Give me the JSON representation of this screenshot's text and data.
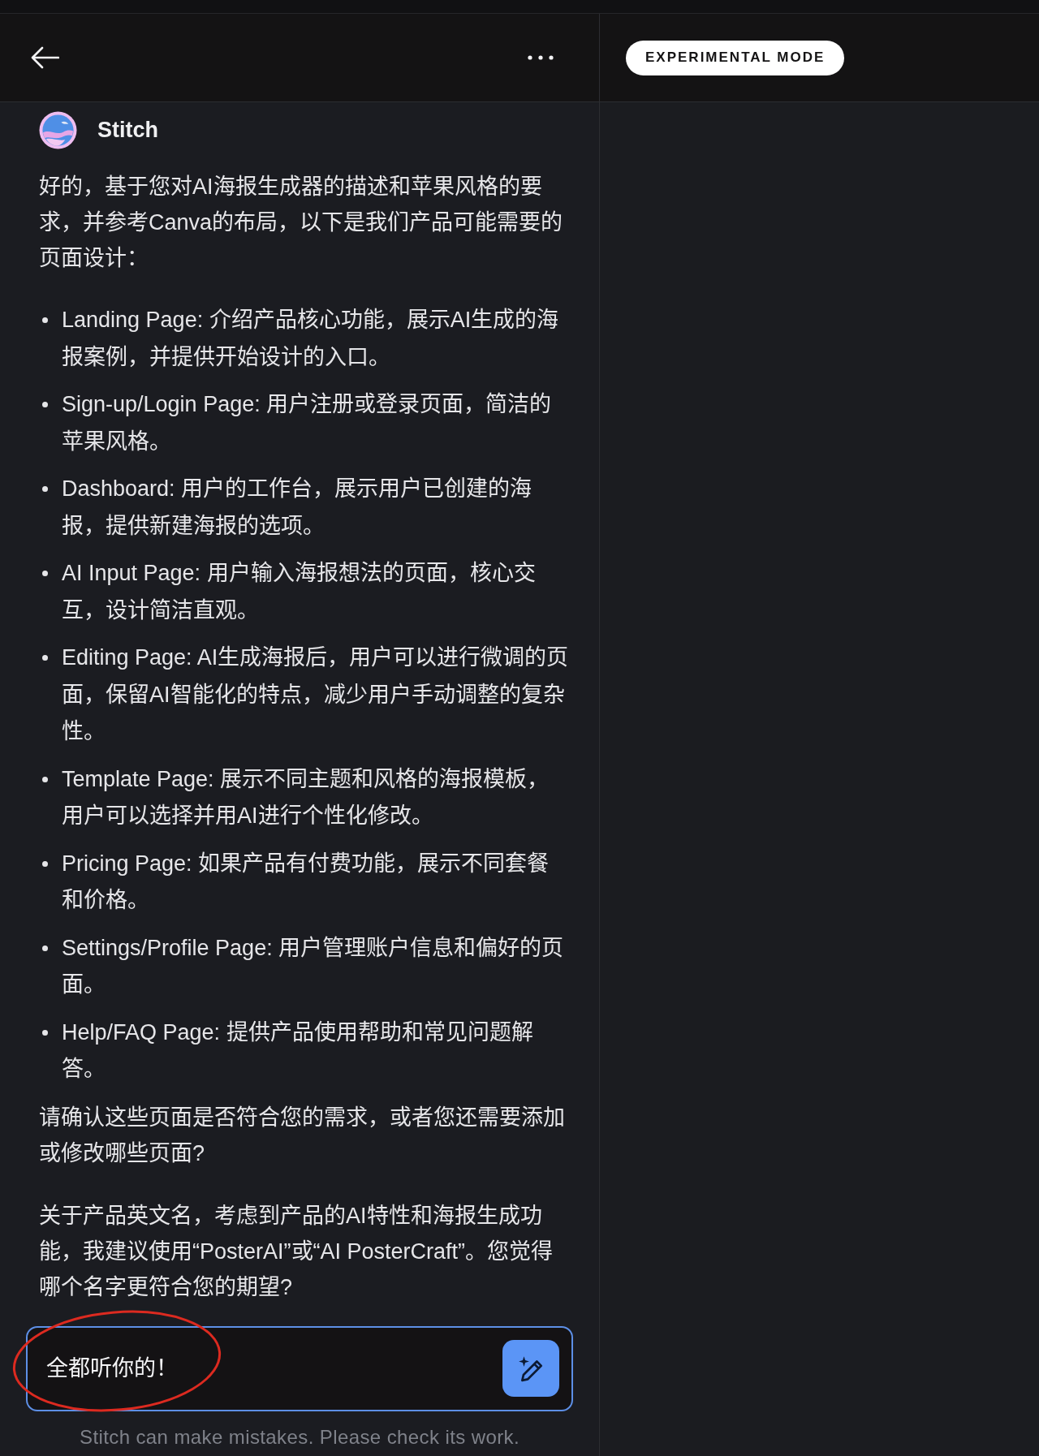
{
  "header": {
    "badge": "EXPERIMENTAL MODE"
  },
  "message": {
    "sender": "Stitch",
    "blocks": [
      {
        "kind": "paragraph",
        "text": "好的，基于您对AI海报生成器的描述和苹果风格的要求，并参考Canva的布局，以下是我们产品可能需要的页面设计："
      },
      {
        "kind": "list",
        "items": [
          "Landing Page: 介绍产品核心功能，展示AI生成的海报案例，并提供开始设计的入口。",
          "Sign-up/Login Page: 用户注册或登录页面，简洁的苹果风格。",
          "Dashboard: 用户的工作台，展示用户已创建的海报，提供新建海报的选项。",
          "AI Input Page: 用户输入海报想法的页面，核心交互，设计简洁直观。",
          "Editing Page: AI生成海报后，用户可以进行微调的页面，保留AI智能化的特点，减少用户手动调整的复杂性。",
          "Template Page: 展示不同主题和风格的海报模板，用户可以选择并用AI进行个性化修改。",
          "Pricing Page: 如果产品有付费功能，展示不同套餐和价格。",
          "Settings/Profile Page: 用户管理账户信息和偏好的页面。",
          "Help/FAQ Page: 提供产品使用帮助和常见问题解答。"
        ]
      },
      {
        "kind": "paragraph",
        "text": "请确认这些页面是否符合您的需求，或者您还需要添加或修改哪些页面?"
      },
      {
        "kind": "paragraph",
        "text": "关于产品英文名，考虑到产品的AI特性和海报生成功能，我建议使用“PosterAI”或“AI PosterCraft”。您觉得哪个名字更符合您的期望?"
      }
    ]
  },
  "composer": {
    "value": "全都听你的！"
  },
  "disclaimer": "Stitch can make mistakes. Please check its work.",
  "annotations": [
    {
      "kind": "ellipse"
    }
  ]
}
